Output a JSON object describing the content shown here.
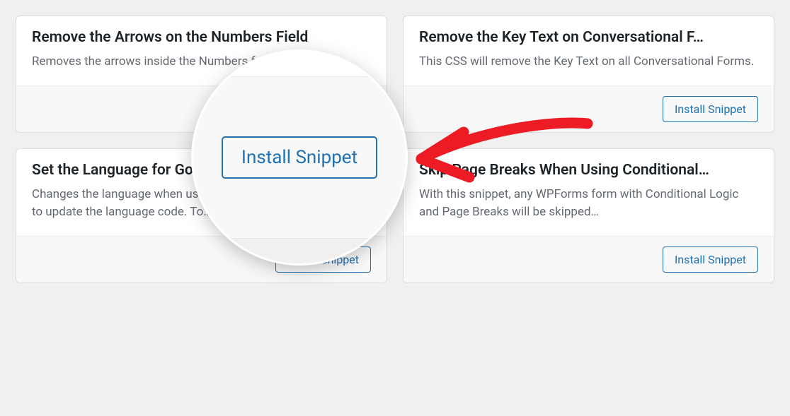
{
  "cards": [
    {
      "title": "Remove the Arrows on the Numbers Field",
      "desc": "Removes the arrows inside the Numbers form field.",
      "button": "Install Snippet"
    },
    {
      "title": "Remove the Key Text on Conversational F…",
      "desc": "This CSS will remove the Key Text on all Conversational Forms.",
      "button": "Install Snippet"
    },
    {
      "title": "Set the Language for Google reCAPTCHA",
      "desc": "Changes the language when using reCAPTCHA. You'll just need to update the language code. To…",
      "button": "Install Snippet"
    },
    {
      "title": "Skip Page Breaks When Using Conditional…",
      "desc": "With this snippet, any WPForms form with Conditional Logic and Page Breaks will be skipped…",
      "button": "Install Snippet"
    }
  ],
  "magnifier": {
    "button": "Install Snippet"
  },
  "annotation": {
    "arrow_color": "#ed1c24"
  }
}
